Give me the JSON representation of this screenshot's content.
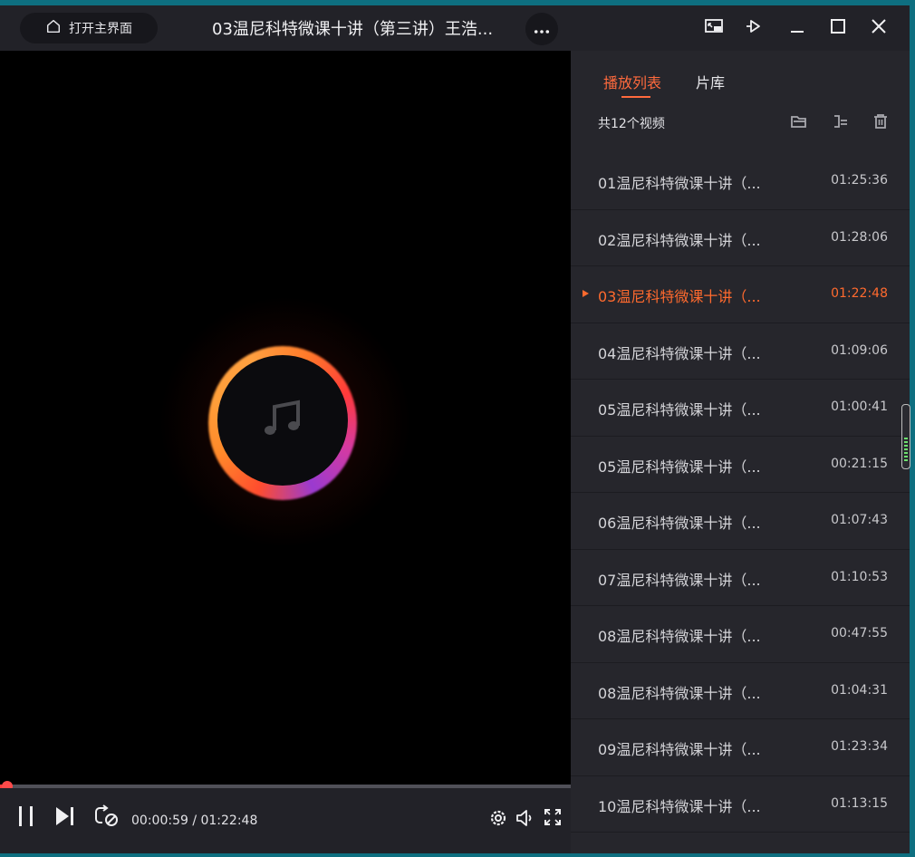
{
  "titlebar": {
    "home_label": "打开主界面",
    "title": "03温尼科特微课十讲（第三讲）王浩...",
    "icons": [
      "home-icon",
      "more-icon",
      "mini-mode-icon",
      "pin-icon",
      "minimize-icon",
      "maximize-icon",
      "close-icon"
    ]
  },
  "player": {
    "current_time": "00:00:59",
    "total_time": "01:22:48",
    "time_display": "00:00:59 / 01:22:48",
    "progress_fraction": 0.012,
    "center_icon": "music-note-icon",
    "accent_color": "#ff4a4a"
  },
  "sidebar": {
    "tabs": [
      {
        "label": "播放列表",
        "active": true
      },
      {
        "label": "片库",
        "active": false
      }
    ],
    "count_label": "共12个视频",
    "accent_color": "#ff6a3d",
    "items": [
      {
        "name": "01温尼科特微课十讲（...",
        "duration": "01:25:36",
        "active": false
      },
      {
        "name": "02温尼科特微课十讲（...",
        "duration": "01:28:06",
        "active": false
      },
      {
        "name": "03温尼科特微课十讲（...",
        "duration": "01:22:48",
        "active": true
      },
      {
        "name": "04温尼科特微课十讲（...",
        "duration": "01:09:06",
        "active": false
      },
      {
        "name": "05温尼科特微课十讲（...",
        "duration": "01:00:41",
        "active": false
      },
      {
        "name": "05温尼科特微课十讲（...",
        "duration": "00:21:15",
        "active": false
      },
      {
        "name": "06温尼科特微课十讲（...",
        "duration": "01:07:43",
        "active": false
      },
      {
        "name": "07温尼科特微课十讲（...",
        "duration": "01:10:53",
        "active": false
      },
      {
        "name": "08温尼科特微课十讲（...",
        "duration": "00:47:55",
        "active": false
      },
      {
        "name": "08温尼科特微课十讲（...",
        "duration": "01:04:31",
        "active": false
      },
      {
        "name": "09温尼科特微课十讲（...",
        "duration": "01:23:34",
        "active": false
      },
      {
        "name": "10温尼科特微课十讲（...",
        "duration": "01:13:15",
        "active": false
      }
    ]
  }
}
